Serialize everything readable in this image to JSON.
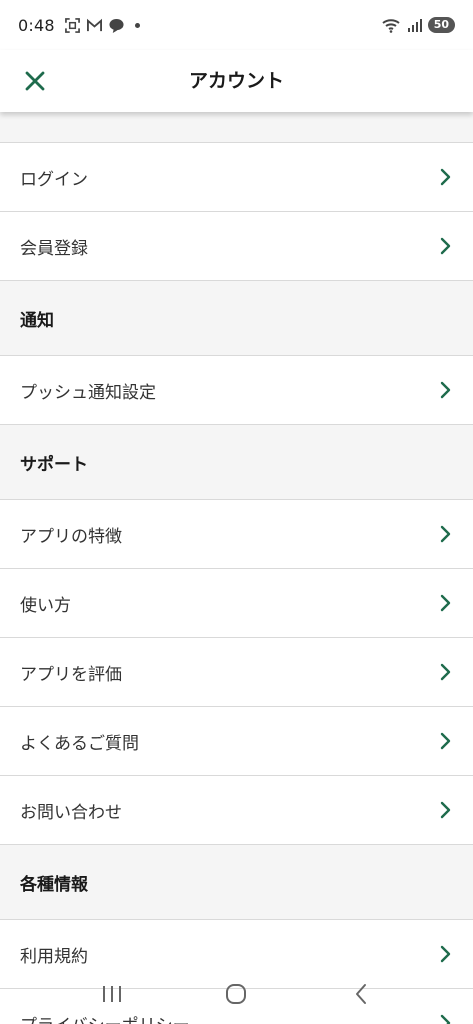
{
  "status_bar": {
    "time": "0:48",
    "left_icons": [
      "screenshot-icon",
      "gmail-icon",
      "line-icon"
    ],
    "right_icons": [
      "wifi-icon",
      "signal-icon"
    ],
    "battery": "50"
  },
  "header": {
    "title": "アカウント",
    "close_icon": "close-icon"
  },
  "colors": {
    "accent": "#1e6b4c",
    "background": "#f5f5f5",
    "row_background": "#ffffff",
    "divider": "#d9d9d9"
  },
  "account": {
    "login": "ログイン",
    "register": "会員登録"
  },
  "notifications": {
    "heading": "通知",
    "push_settings": "プッシュ通知設定"
  },
  "support": {
    "heading": "サポート",
    "features": "アプリの特徴",
    "how_to_use": "使い方",
    "rate_app": "アプリを評価",
    "faq": "よくあるご質問",
    "contact": "お問い合わせ"
  },
  "info": {
    "heading": "各種情報",
    "terms": "利用規約",
    "privacy": "プライバシーポリシー"
  },
  "nav_bar": {
    "icons": [
      "recent-apps-icon",
      "home-icon",
      "back-icon"
    ]
  }
}
